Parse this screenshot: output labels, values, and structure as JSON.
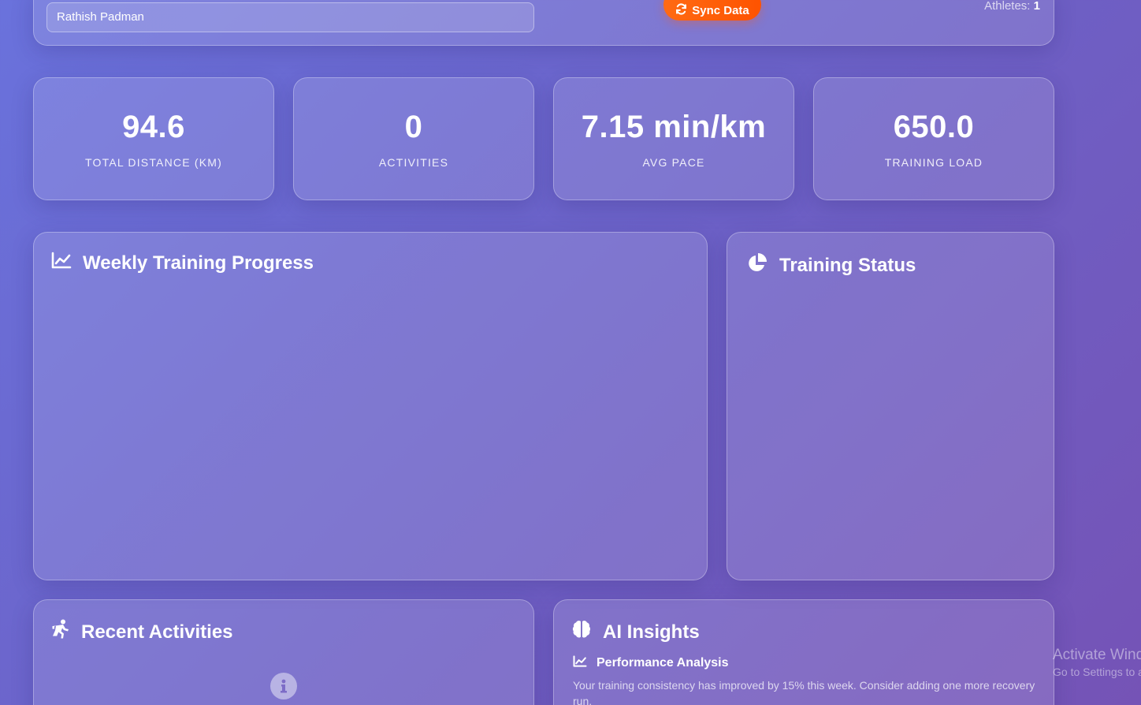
{
  "header": {
    "athlete_name": "Rathish Padman",
    "sync_label": "Sync Data",
    "athletes_label": "Athletes:",
    "athletes_count": "1"
  },
  "stats": [
    {
      "value": "94.6",
      "label": "TOTAL DISTANCE (KM)"
    },
    {
      "value": "0",
      "label": "ACTIVITIES"
    },
    {
      "value": "7.15 min/km",
      "label": "AVG PACE"
    },
    {
      "value": "650.0",
      "label": "TRAINING LOAD"
    }
  ],
  "panels": {
    "weekly_progress": {
      "title": "Weekly Training Progress",
      "icon": "chart-line-icon"
    },
    "training_status": {
      "title": "Training Status",
      "icon": "pie-chart-icon"
    },
    "recent_activities": {
      "title": "Recent Activities",
      "icon": "running-icon"
    },
    "ai_insights": {
      "title": "AI Insights",
      "icon": "brain-icon",
      "section_title": "Performance Analysis",
      "section_text": "Your training consistency has improved by 15% this week. Consider adding one more recovery run."
    }
  },
  "watermark": {
    "line1": "Activate Windows",
    "line2": "Go to Settings to activate Windows."
  }
}
